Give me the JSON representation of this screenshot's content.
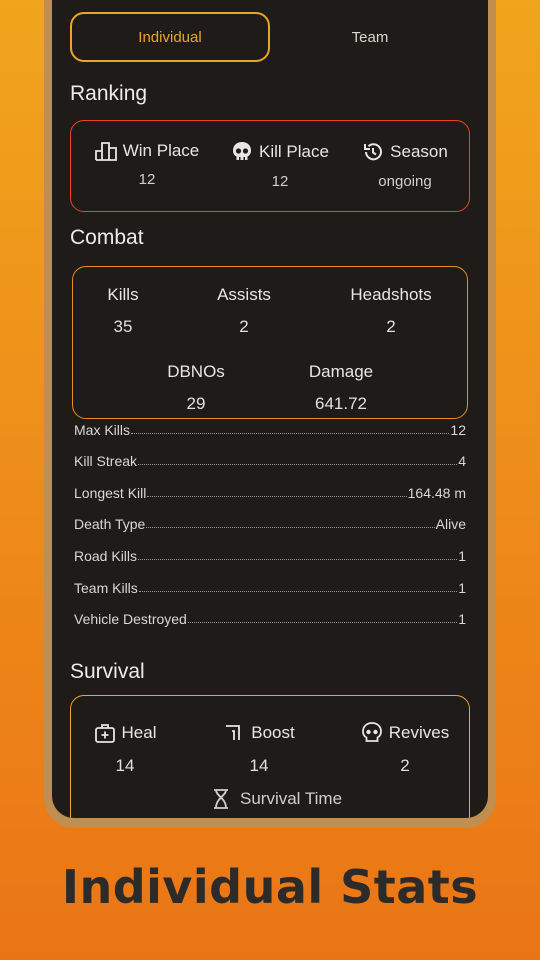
{
  "tabs": {
    "individual": "Individual",
    "team": "Team"
  },
  "ranking": {
    "title": "Ranking",
    "items": [
      {
        "icon": "podium-icon",
        "label": "Win Place",
        "value": "12"
      },
      {
        "icon": "skull-icon",
        "label": "Kill Place",
        "value": "12"
      },
      {
        "icon": "history-icon",
        "label": "Season",
        "value": "ongoing"
      }
    ]
  },
  "combat": {
    "title": "Combat",
    "items": [
      {
        "label": "Kills",
        "value": "35"
      },
      {
        "label": "Assists",
        "value": "2"
      },
      {
        "label": "Headshots",
        "value": "2"
      },
      {
        "label": "DBNOs",
        "value": "29"
      },
      {
        "label": "Damage",
        "value": "641.72"
      }
    ],
    "rows": [
      {
        "label": "Max Kills",
        "value": "12"
      },
      {
        "label": "Kill Streak",
        "value": "4"
      },
      {
        "label": "Longest Kill",
        "value": "164.48 m"
      },
      {
        "label": "Death Type",
        "value": "Alive"
      },
      {
        "label": "Road Kills",
        "value": "1"
      },
      {
        "label": "Team Kills",
        "value": "1"
      },
      {
        "label": "Vehicle Destroyed",
        "value": "1"
      }
    ]
  },
  "survival": {
    "title": "Survival",
    "items": [
      {
        "icon": "medkit-icon",
        "label": "Heal",
        "value": "14"
      },
      {
        "icon": "boost-icon",
        "label": "Boost",
        "value": "14"
      },
      {
        "icon": "skull-icon",
        "label": "Revives",
        "value": "2"
      }
    ],
    "partial_item": {
      "icon": "hourglass-icon",
      "label": "Survival Time"
    }
  },
  "footer": {
    "title": "Individual Stats"
  },
  "colors": {
    "accent": "#eaa524",
    "ranking_border": "#e8452a",
    "combat_border": "#e98d1f",
    "panel": "#1f1b19"
  }
}
